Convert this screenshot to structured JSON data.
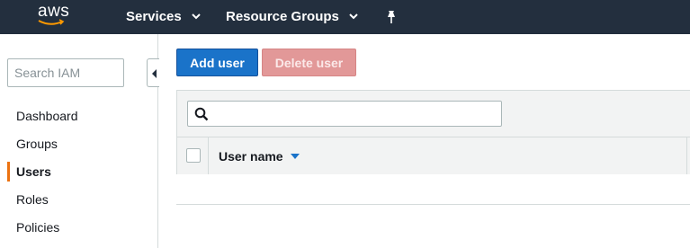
{
  "topbar": {
    "logo_text": "aws",
    "services_label": "Services",
    "resource_groups_label": "Resource Groups"
  },
  "sidebar": {
    "search_placeholder": "Search IAM",
    "items": [
      {
        "label": "Dashboard"
      },
      {
        "label": "Groups"
      },
      {
        "label": "Users",
        "active": true
      },
      {
        "label": "Roles"
      },
      {
        "label": "Policies"
      }
    ]
  },
  "toolbar": {
    "add_user_label": "Add user",
    "delete_user_label": "Delete user"
  },
  "table": {
    "filter_value": "",
    "columns": [
      {
        "label": "User name",
        "sorted": "descending"
      }
    ]
  },
  "colors": {
    "nav_bg": "#232f3e",
    "primary": "#1a73c9",
    "danger_disabled": "#e29898",
    "active_marker": "#ec7211"
  }
}
